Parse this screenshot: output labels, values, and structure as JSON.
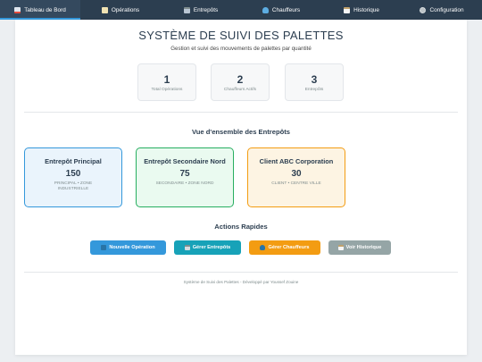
{
  "nav": {
    "items": [
      {
        "label": "Tableau de Bord",
        "icon": "chart-icon"
      },
      {
        "label": "Opérations",
        "icon": "memo-icon"
      },
      {
        "label": "Entrepôts",
        "icon": "building-icon"
      },
      {
        "label": "Chauffeurs",
        "icon": "person-icon"
      },
      {
        "label": "Historique",
        "icon": "clipboard-icon"
      },
      {
        "label": "Configuration",
        "icon": "gear-icon"
      }
    ],
    "active": "Tableau de Bord"
  },
  "header": {
    "title": "SYSTÈME DE SUIVI DES PALETTES",
    "subtitle": "Gestion et suivi des mouvements de palettes par quantité"
  },
  "stats": [
    {
      "value": "1",
      "label": "Total Opérations"
    },
    {
      "value": "2",
      "label": "Chauffeurs Actifs"
    },
    {
      "value": "3",
      "label": "Entrepôts"
    }
  ],
  "warehouses_section": {
    "title": "Vue d'ensemble des Entrepôts",
    "items": [
      {
        "name": "Entrepôt Principal",
        "quantity": "150",
        "meta": "PRINCIPAL • ZONE INDUSTRIELLE",
        "color": "#3498db"
      },
      {
        "name": "Entrepôt Secondaire Nord",
        "quantity": "75",
        "meta": "SECONDAIRE • ZONE NORD",
        "color": "#27ae60"
      },
      {
        "name": "Client ABC Corporation",
        "quantity": "30",
        "meta": "CLIENT • CENTRE VILLE",
        "color": "#f39c12"
      }
    ]
  },
  "actions": {
    "title": "Actions Rapides",
    "buttons": [
      {
        "label": "Nouvelle Opération",
        "icon": "plus-icon",
        "color": "#3498db"
      },
      {
        "label": "Gérer Entrepôts",
        "icon": "building-icon",
        "color": "#17a2b8"
      },
      {
        "label": "Gérer Chauffeurs",
        "icon": "person-icon",
        "color": "#f39c12"
      },
      {
        "label": "Voir Historique",
        "icon": "clipboard-icon",
        "color": "#95a5a6"
      }
    ]
  },
  "footer": {
    "text": "Système de Suivi des Palettes - Développé par Youssef Zouine"
  }
}
